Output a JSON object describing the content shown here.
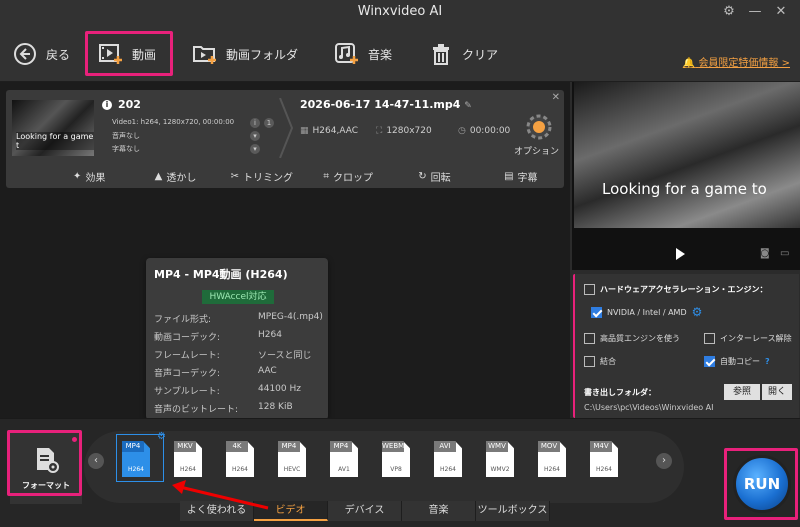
{
  "app": {
    "title": "Winxvideo AI"
  },
  "toolbar": {
    "back": "戻る",
    "video": "動画",
    "video_folder": "動画フォルダ",
    "music": "音楽",
    "clear": "クリア",
    "promo": "会員限定特価情報 >"
  },
  "source": {
    "name": "202",
    "line1": "Video1: h264, 1280x720, 00:00:00",
    "line2": "音声なし",
    "line3": "字幕なし",
    "thumb_caption": "Looking for a game t"
  },
  "output": {
    "name": "2026-06-17 14-47-11.mp4",
    "codec": "H264,AAC",
    "resolution": "1280x720",
    "duration": "00:00:00",
    "option_label": "オプション"
  },
  "edit_tools": [
    "効果",
    "透かし",
    "トリミング",
    "クロップ",
    "回転",
    "字幕"
  ],
  "popup": {
    "title": "MP4 - MP4動画 (H264)",
    "badge": "HWAccel対応",
    "rows": [
      {
        "k": "ファイル形式:",
        "v": "MPEG-4(.mp4)"
      },
      {
        "k": "動画コーデック:",
        "v": "H264"
      },
      {
        "k": "フレームレート:",
        "v": "ソースと同じ"
      },
      {
        "k": "音声コーデック:",
        "v": "AAC"
      },
      {
        "k": "サンプルレート:",
        "v": "44100 Hz"
      },
      {
        "k": "音声のビットレート:",
        "v": "128 KiB"
      }
    ]
  },
  "preview": {
    "caption": "Looking for a game to"
  },
  "settings": {
    "hw_engine": "ハードウェアアクセラレーション・エンジン：",
    "nvidia": "NVIDIA / Intel / AMD",
    "hq_engine": "高品質エンジンを使う",
    "deinterlace": "インターレース解除",
    "merge": "結合",
    "auto_copy": "自動コピー",
    "help": "?",
    "output_folder_label": "書き出しフォルダ：",
    "browse": "参照",
    "open": "開く",
    "path": "C:\\Users\\pc\\Videos\\Winxvideo AI"
  },
  "bottom": {
    "format_label": "フォーマット",
    "tabs": [
      "よく使われる",
      "ビデオ",
      "デバイス",
      "音楽",
      "ツールボックス"
    ],
    "active_tab": "ビデオ",
    "formats": [
      {
        "top": "MP4",
        "bot": "H264",
        "selected": true
      },
      {
        "top": "MKV",
        "bot": "H264"
      },
      {
        "top": "4K",
        "bot": "H264"
      },
      {
        "top": "MP4",
        "bot": "HEVC"
      },
      {
        "top": "MP4",
        "bot": "AV1"
      },
      {
        "top": "WEBM",
        "bot": "VP8"
      },
      {
        "top": "AVI",
        "bot": "H264"
      },
      {
        "top": "WMV",
        "bot": "WMV2"
      },
      {
        "top": "MOV",
        "bot": "H264"
      },
      {
        "top": "M4V",
        "bot": "H264"
      }
    ],
    "run": "RUN"
  },
  "colors": {
    "highlight": "#e8217b",
    "accent_orange": "#f5a142",
    "accent_blue": "#2d8fe8"
  }
}
